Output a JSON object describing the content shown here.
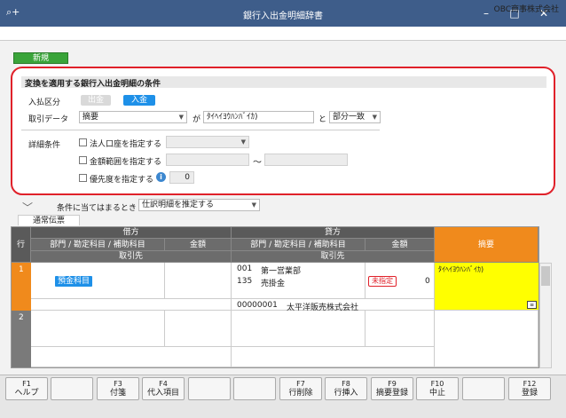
{
  "window": {
    "title": "銀行入出金明細辞書",
    "company": "OBC商事株式会社",
    "min": "–",
    "max": "□",
    "close": "✕"
  },
  "toolbar": {
    "new_label": "新規"
  },
  "conditions": {
    "title": "変換を適用する銀行入出金明細の条件",
    "direction_label": "入払区分",
    "out_label": "出金",
    "in_label": "入金",
    "data_label": "取引データ",
    "data_field": "摘要",
    "ga": "が",
    "search_text": "ﾀｲﾍｲﾖｳﾊﾝﾊﾞｲｶ)",
    "to": "と",
    "match": "部分一致",
    "detail_label": "詳細条件",
    "bank_label": "法人口座を指定する",
    "amount_label": "金額範囲を指定する",
    "range_sep": "～",
    "priority_label": "優先度を指定する",
    "priority_value": "0"
  },
  "apply": {
    "label": "条件に当てはまるとき",
    "option": "仕訳明細を推定する"
  },
  "tab": {
    "label": "通常伝票"
  },
  "grid": {
    "row_hdr": "行",
    "debit": "借方",
    "credit": "貸方",
    "account_hdr": "部門 / 勘定科目 / 補助科目",
    "amount_hdr": "金額",
    "partner_hdr": "取引先",
    "memo_hdr": "摘要",
    "rows": [
      {
        "no": "1",
        "debit_account": "預金科目",
        "credit_dept_code": "001",
        "credit_dept": "第一営業部",
        "credit_acct_code": "135",
        "credit_acct": "売掛金",
        "credit_status": "未指定",
        "credit_amount": "0",
        "partner_code": "00000001",
        "partner_name": "太平洋販売株式会社",
        "memo": "ﾀｲﾍｲﾖｳﾊﾝﾊﾞｲｶ)"
      },
      {
        "no": "2"
      }
    ]
  },
  "fkeys": [
    {
      "key": "F1",
      "label": "ヘルプ"
    },
    {
      "key": "",
      "label": ""
    },
    {
      "key": "F3",
      "label": "付箋"
    },
    {
      "key": "F4",
      "label": "代入項目"
    },
    {
      "key": "",
      "label": ""
    },
    {
      "key": "",
      "label": ""
    },
    {
      "key": "F7",
      "label": "行削除"
    },
    {
      "key": "F8",
      "label": "行挿入"
    },
    {
      "key": "F9",
      "label": "摘要登録"
    },
    {
      "key": "F10",
      "label": "中止"
    },
    {
      "key": "",
      "label": ""
    },
    {
      "key": "F12",
      "label": "登録"
    }
  ],
  "colors": {
    "accent": "#3e5d8a",
    "highlight_red": "#e0212a",
    "memo_yellow": "#ffff00",
    "memo_header": "#f08a1c",
    "row_orange": "#f08a1c"
  }
}
